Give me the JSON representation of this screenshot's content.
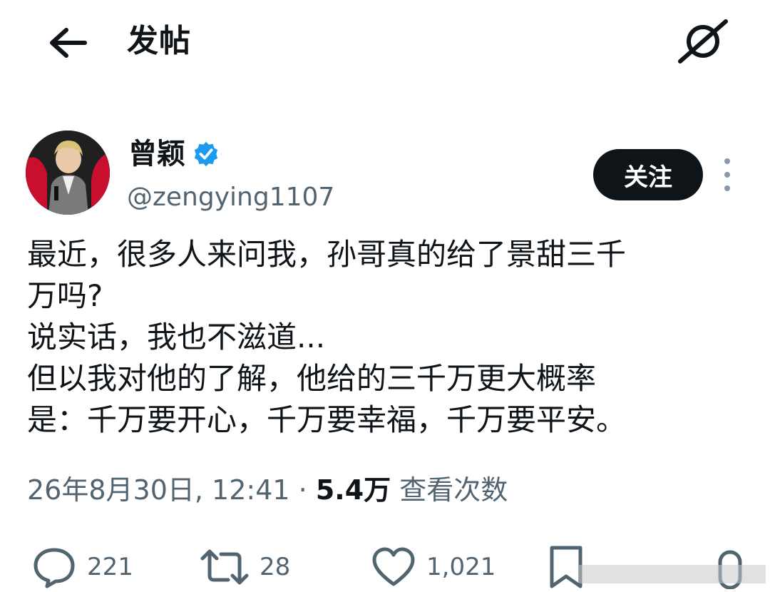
{
  "header": {
    "title": "发帖",
    "back_icon": "arrow-left-icon",
    "grok_icon": "grok-icon"
  },
  "author": {
    "display_name": "曾颖",
    "handle": "@zengying1107",
    "verified": true,
    "verified_color": "#1d9bf0",
    "follow_label": "关注"
  },
  "post": {
    "lines": [
      "最近，很多人来问我，孙哥真的给了景甜三千",
      "万吗?",
      "说实话，我也不滋道...",
      "但以我对他的了解，他给的三千万更大概率",
      "是：千万要开心，千万要幸福，千万要平安。"
    ]
  },
  "meta": {
    "timestamp": "26年8月30日, 12:41",
    "separator": " · ",
    "views_count": "5.4万",
    "views_label": " 查看次数"
  },
  "actions": {
    "reply_count": "221",
    "retweet_count": "28",
    "like_count": "1,021"
  },
  "colors": {
    "text": "#0f1419",
    "secondary": "#536471",
    "follow_bg": "#0f1419"
  }
}
